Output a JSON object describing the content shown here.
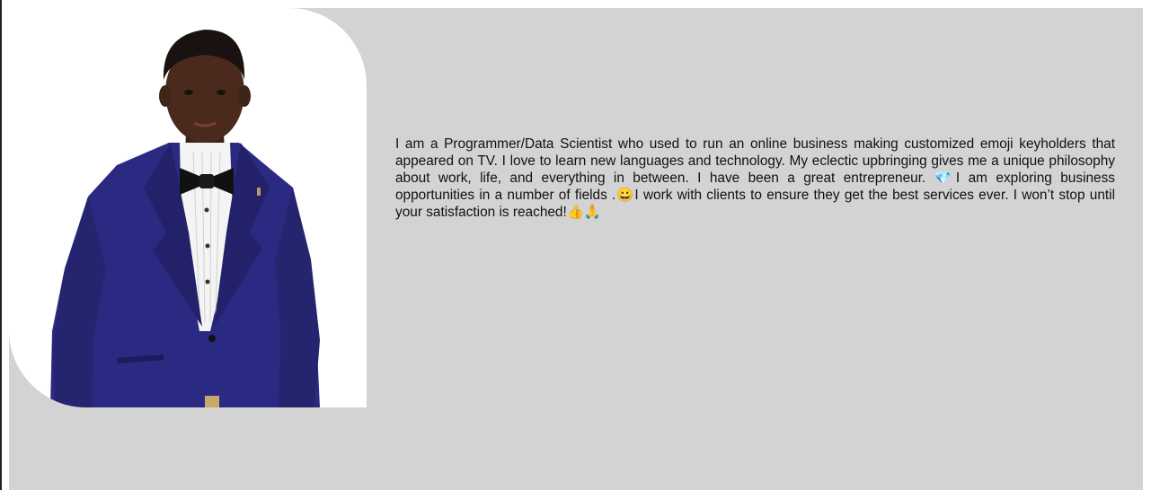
{
  "profile": {
    "photo_alt": "Portrait of a young man in a navy blue suit with a black bow tie",
    "bio_text": "I am a Programmer/Data Scientist who used to run an online business making customized emoji keyholders that appeared on TV. I love to learn new languages and technology. My eclectic upbringing gives me a unique philosophy about work, life, and everything in between. I have been a great entrepreneur. 💎I am exploring business opportunities in a number of fields .😀I work with clients to ensure they get the best services ever. I won’t stop until your satisfaction is reached!👍🙏"
  },
  "colors": {
    "panel_background": "#d3d3d3",
    "suit": "#2b2a82",
    "text": "#111111"
  }
}
